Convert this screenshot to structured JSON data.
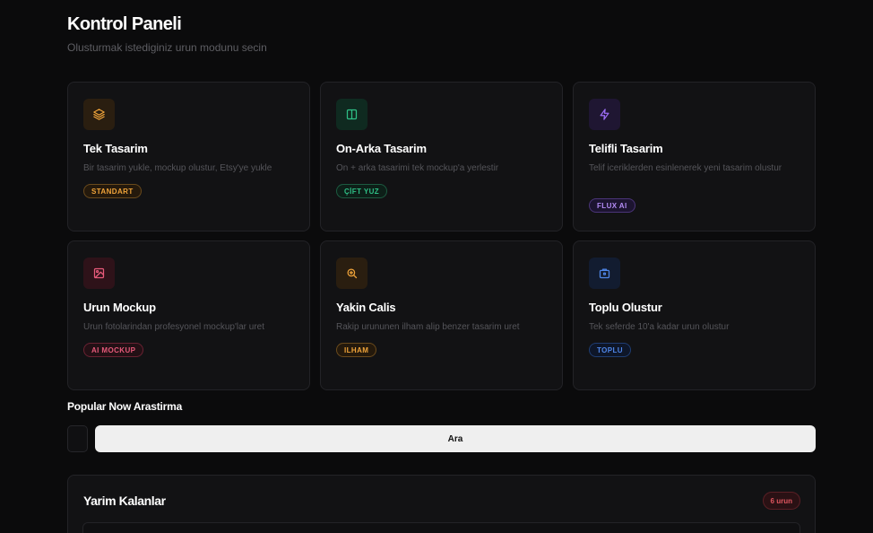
{
  "header": {
    "title": "Kontrol Paneli",
    "subtitle": "Olusturmak istediginiz urun modunu secin"
  },
  "cards": [
    {
      "title": "Tek Tasarim",
      "description": "Bir tasarim yukle, mockup olustur, Etsy'ye yukle",
      "badge": "STANDART",
      "icon": "layers-icon",
      "accent": "#f0a43a"
    },
    {
      "title": "On-Arka Tasarim",
      "description": "On + arka tasarimi tek mockup'a yerlestir",
      "badge": "ÇİFT YUZ",
      "icon": "columns-icon",
      "accent": "#2fbf86"
    },
    {
      "title": "Telifli Tasarim",
      "description": "Telif iceriklerden esinlenerek yeni tasarim olustur",
      "badge": "FLUX AI",
      "icon": "lightning-icon",
      "accent": "#9b6cf2"
    },
    {
      "title": "Urun Mockup",
      "description": "Urun fotolarindan profesyonel mockup'lar uret",
      "badge": "AI MOCKUP",
      "icon": "image-icon",
      "accent": "#e65a7a"
    },
    {
      "title": "Yakin Calis",
      "description": "Rakip urununen ilham alip benzer tasarim uret",
      "badge": "ILHAM",
      "icon": "search-zoom-icon",
      "accent": "#f0a43a"
    },
    {
      "title": "Toplu Olustur",
      "description": "Tek seferde 10'a kadar urun olustur",
      "badge": "TOPLU",
      "icon": "package-icon",
      "accent": "#4f86e8"
    }
  ],
  "research": {
    "title": "Popular Now Arastirma",
    "button_label": "Ara"
  },
  "drafts": {
    "title": "Yarim Kalanlar",
    "count": "6 urun"
  }
}
